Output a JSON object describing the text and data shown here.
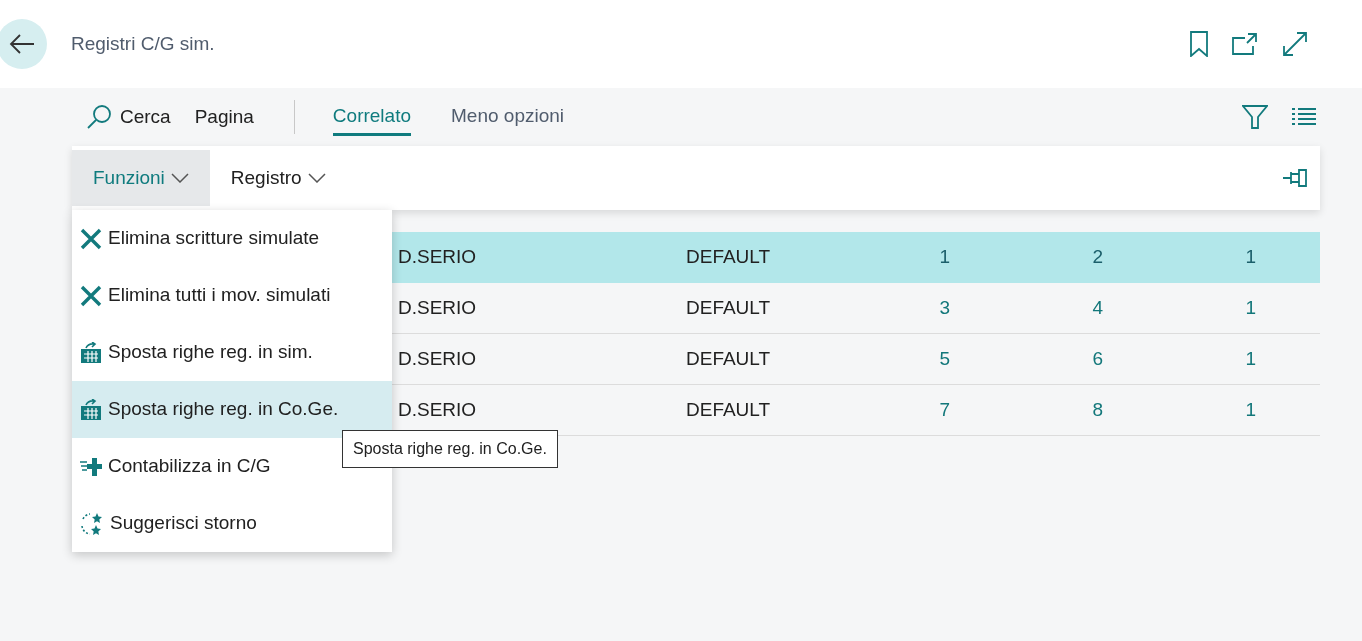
{
  "header": {
    "title": "Registri C/G sim."
  },
  "action_bar": {
    "search": {
      "label": "Cerca"
    },
    "page": {
      "label": "Pagina"
    },
    "tabs": [
      {
        "label": "Correlato",
        "selected": true
      }
    ],
    "toggle": {
      "label": "Meno opzioni"
    }
  },
  "ribbon": {
    "menus": [
      {
        "label": "Funzioni",
        "expanded": true
      },
      {
        "label": "Registro",
        "expanded": false
      }
    ]
  },
  "dropdown": {
    "items": [
      {
        "label": "Elimina scritture simulate",
        "kind": "delete",
        "selected": false
      },
      {
        "label": "Elimina tutti i mov. simulati",
        "kind": "delete",
        "selected": false
      },
      {
        "label": "Sposta righe reg. in sim.",
        "kind": "move",
        "selected": false
      },
      {
        "label": "Sposta righe reg. in Co.Ge.",
        "kind": "move",
        "selected": true
      },
      {
        "label": "Contabilizza in C/G",
        "kind": "post",
        "selected": false
      },
      {
        "label": "Suggerisci storno",
        "kind": "suggest",
        "selected": false
      }
    ]
  },
  "tooltip": "Sposta righe reg. in Co.Ge.",
  "table": {
    "rows": [
      {
        "selected": true,
        "cells": [
          "D.SERIO",
          "DEFAULT",
          "1",
          "2",
          "1"
        ]
      },
      {
        "selected": false,
        "cells": [
          "D.SERIO",
          "DEFAULT",
          "3",
          "4",
          "1"
        ]
      },
      {
        "selected": false,
        "cells": [
          "D.SERIO",
          "DEFAULT",
          "5",
          "6",
          "1"
        ]
      },
      {
        "selected": false,
        "cells": [
          "D.SERIO",
          "DEFAULT",
          "7",
          "8",
          "1"
        ]
      }
    ]
  }
}
